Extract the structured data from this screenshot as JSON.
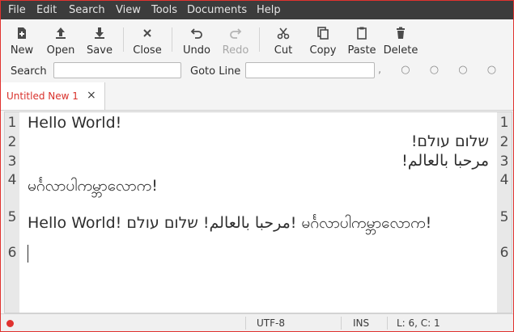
{
  "menu": [
    "File",
    "Edit",
    "Search",
    "View",
    "Tools",
    "Documents",
    "Help"
  ],
  "toolbar": {
    "new": "New",
    "open": "Open",
    "save": "Save",
    "close": "Close",
    "undo": "Undo",
    "redo": "Redo",
    "cut": "Cut",
    "copy": "Copy",
    "paste": "Paste",
    "delete": "Delete"
  },
  "search": {
    "label": "Search",
    "value": ""
  },
  "goto": {
    "label": "Goto Line",
    "value": ""
  },
  "extra_chars": ", ○ ○ ○ ○ ` ○ ~",
  "tab": {
    "title": "Untitled New 1",
    "close": "×"
  },
  "editor": {
    "line_numbers": [
      "1",
      "2",
      "3",
      "4",
      "5",
      "6"
    ],
    "lines": [
      "Hello World!",
      "שלום עולם!",
      "مرحبا بالعالم!",
      "မင်္ဂလာပါကမ္ဘာလောက!",
      "Hello World! مرحبا بالعالم! שלום עולם! မင်္ဂလာပါကမ္ဘာလောက!",
      ""
    ]
  },
  "status": {
    "encoding": "UTF-8",
    "mode": "INS",
    "position": "L: 6, C: 1"
  },
  "colors": {
    "accent": "#e0322f",
    "menubar_bg": "#3c3c3c"
  }
}
